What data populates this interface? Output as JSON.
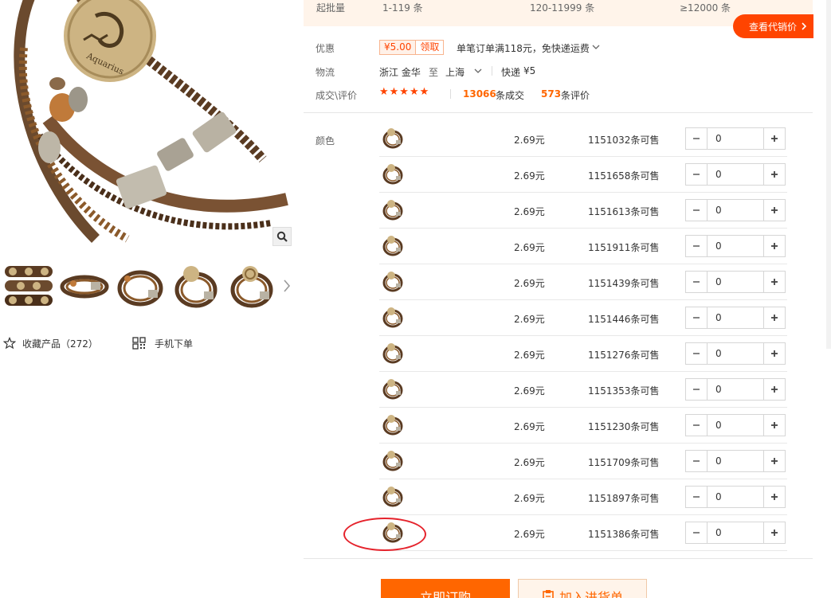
{
  "price_band": {
    "label": "起批量",
    "tier1": "1-119 条",
    "tier2": "120-11999 条",
    "tier3": "≥12000 条"
  },
  "agent_button": {
    "label": "查看代销价"
  },
  "promo": {
    "label": "优惠",
    "amount": "¥5.00",
    "claim": "领取",
    "text": "单笔订单满118元，免快递运费"
  },
  "logistics": {
    "label": "物流",
    "from": "浙江 金华",
    "to_word": "至",
    "to": "上海",
    "method": "快递",
    "fee": "¥5"
  },
  "deals": {
    "label": "成交\\评价",
    "stars": "★★★★★",
    "deal_count": "13066",
    "deal_suffix": "条成交",
    "review_count": "573",
    "review_suffix": "条评价"
  },
  "sku": {
    "label": "颜色",
    "rows": [
      {
        "price": "2.69元",
        "stock": "1151032条可售",
        "qty": "0"
      },
      {
        "price": "2.69元",
        "stock": "1151658条可售",
        "qty": "0"
      },
      {
        "price": "2.69元",
        "stock": "1151613条可售",
        "qty": "0"
      },
      {
        "price": "2.69元",
        "stock": "1151911条可售",
        "qty": "0"
      },
      {
        "price": "2.69元",
        "stock": "1151439条可售",
        "qty": "0"
      },
      {
        "price": "2.69元",
        "stock": "1151446条可售",
        "qty": "0"
      },
      {
        "price": "2.69元",
        "stock": "1151276条可售",
        "qty": "0"
      },
      {
        "price": "2.69元",
        "stock": "1151353条可售",
        "qty": "0"
      },
      {
        "price": "2.69元",
        "stock": "1151230条可售",
        "qty": "0"
      },
      {
        "price": "2.69元",
        "stock": "1151709条可售",
        "qty": "0"
      },
      {
        "price": "2.69元",
        "stock": "1151897条可售",
        "qty": "0"
      },
      {
        "price": "2.69元",
        "stock": "1151386条可售",
        "qty": "0"
      }
    ]
  },
  "gallery": {
    "thumb_count": 5,
    "favorite_label": "收藏产品（272）",
    "mobile_label": "手机下单",
    "medallion_text": "Aquarius"
  },
  "actions": {
    "buy_label": "立即订购",
    "cart_label": "加入进货单"
  },
  "colors": {
    "accent": "#ff6600",
    "brand_red": "#ff4400",
    "annotation": "#e5232c"
  }
}
